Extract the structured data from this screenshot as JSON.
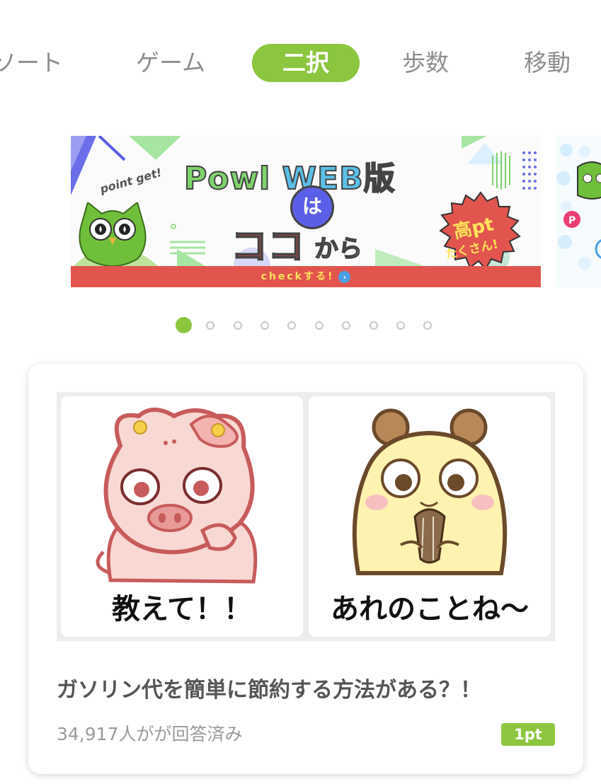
{
  "tabs": [
    {
      "label": "ソート",
      "active": false
    },
    {
      "label": "ゲーム",
      "active": false
    },
    {
      "label": "二択",
      "active": true
    },
    {
      "label": "歩数",
      "active": false
    },
    {
      "label": "移動",
      "active": false
    }
  ],
  "banner": {
    "point_text": "point get!",
    "title_powl": "Powl ",
    "title_web": "WEB",
    "title_han": "版",
    "wa": "は",
    "koko": "ココ",
    "kara": "から",
    "burst_line1": "高pt",
    "burst_line2": "たくさん!",
    "cta": "checkする!",
    "cta_arrow": "›"
  },
  "carousel": {
    "page_count": 10,
    "active_index": 0
  },
  "card": {
    "caption_left": "教えて！！",
    "caption_right": "あれのことね〜",
    "title": "ガソリン代を簡単に節約する方法がある？！",
    "answered": "34,917人がが回答済み",
    "points": "1pt"
  },
  "colors": {
    "accent_green": "#8cc63f",
    "banner_red": "#e2554e",
    "owl_green": "#6fbf3a"
  }
}
